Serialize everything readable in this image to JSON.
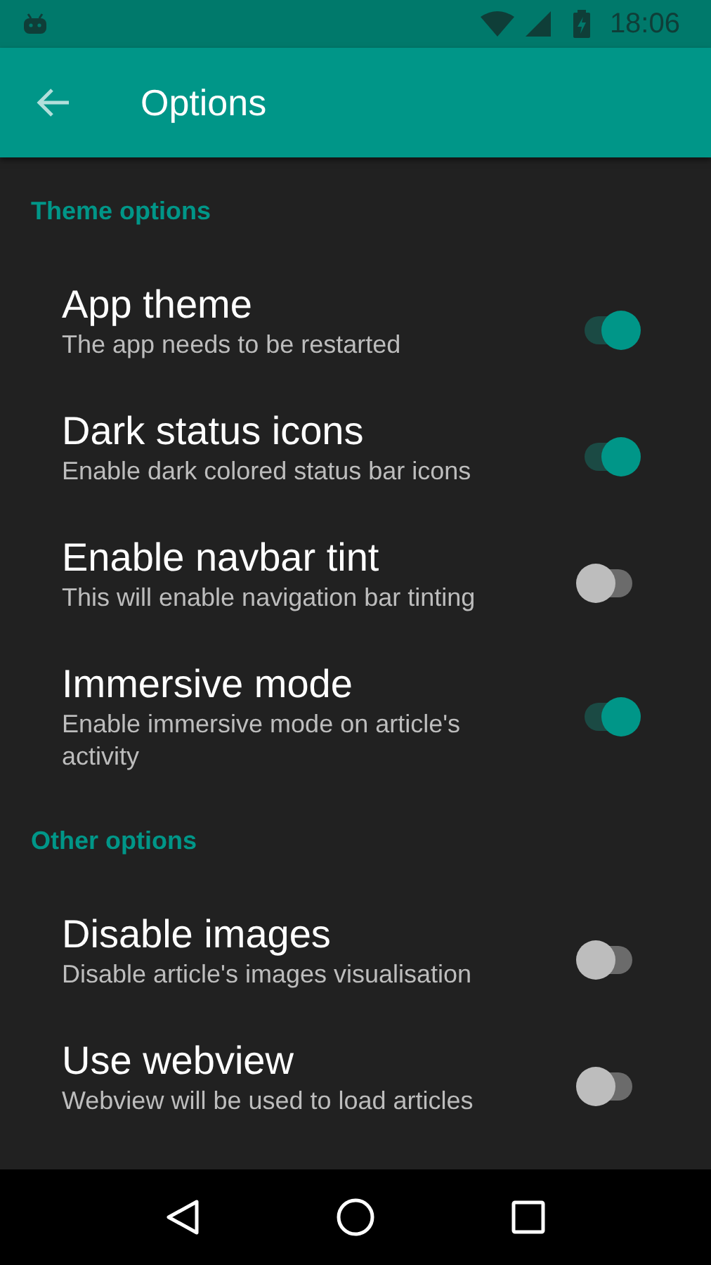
{
  "status_bar": {
    "time": "18:06"
  },
  "toolbar": {
    "title": "Options"
  },
  "sections": [
    {
      "title": "Theme options",
      "items": [
        {
          "title": "App theme",
          "subtitle": "The app needs to be restarted",
          "on": true
        },
        {
          "title": "Dark status icons",
          "subtitle": "Enable dark colored status bar icons",
          "on": true
        },
        {
          "title": "Enable navbar tint",
          "subtitle": "This will enable navigation bar tinting",
          "on": false
        },
        {
          "title": "Immersive mode",
          "subtitle": "Enable immersive mode on article's activity",
          "on": true
        }
      ]
    },
    {
      "title": "Other options",
      "items": [
        {
          "title": "Disable images",
          "subtitle": "Disable article's images visualisation",
          "on": false
        },
        {
          "title": "Use webview",
          "subtitle": "Webview will be used to load articles",
          "on": false
        }
      ]
    }
  ]
}
